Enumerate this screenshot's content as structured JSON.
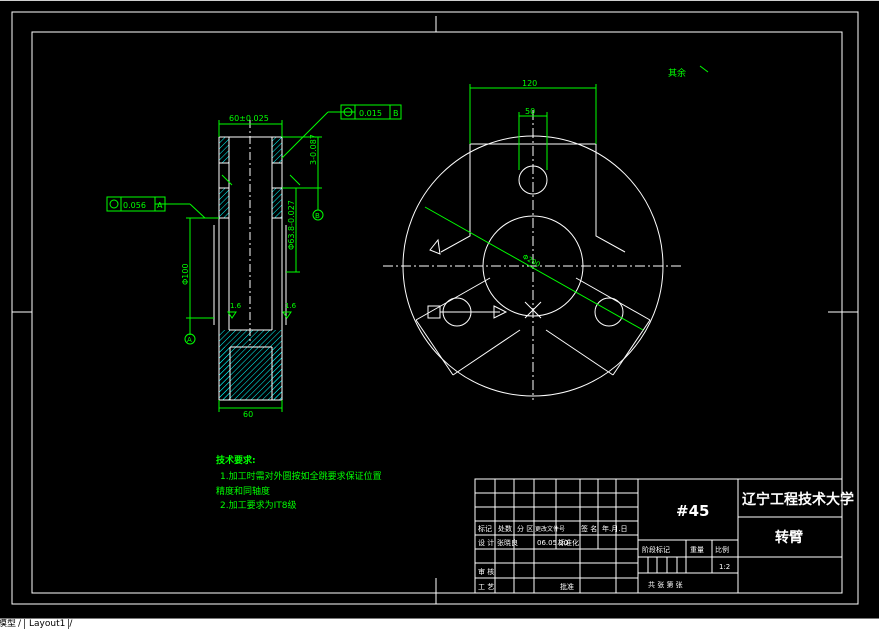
{
  "drawing": {
    "title_block": {
      "material": "#45",
      "school": "辽宁工程技术大学",
      "part_name": "转臂",
      "scale_value": "1:2",
      "header_labels": [
        "标记",
        "处数",
        "分 区",
        "更改文件号",
        "签 名",
        "年.月.日"
      ],
      "design_label": "设 计",
      "designer": "张晓良",
      "design_date": "06.05.20",
      "standardize_label": "标准化",
      "stage_headers": [
        "阶段标记",
        "重量",
        "比例"
      ],
      "review_label": "审 核",
      "process_label": "工 艺",
      "approve_label": "批准",
      "sheet_text": "共  张  第  张"
    },
    "notes": {
      "heading": "技术要求:",
      "line1": "1.加工时需对外圆按如全跳要求保证位置",
      "line2": "精度和同轴度",
      "line3": "2.加工要求为IT8级"
    },
    "dimensions": {
      "top_width": "60±0.025",
      "tol_frame_top": "0.015",
      "tol_frame_left": "0.056",
      "depth": "3-0.087",
      "bore": "Φ63.8-0.027",
      "height": "Φ100",
      "roughness_a": "1.6",
      "roughness_b": "1.6",
      "bottom_width": "60",
      "datum_a": "A",
      "datum_b": "B",
      "front_total": "120",
      "front_slot": "50",
      "diameter_label": "Φ200",
      "surface_rest": "其余"
    }
  },
  "tabs": {
    "model": "模型",
    "layout": "Layout1"
  },
  "colors": {
    "background": "#000000",
    "dimension": "#00ff00",
    "outline": "#ffffff",
    "section": "#00ffff"
  }
}
